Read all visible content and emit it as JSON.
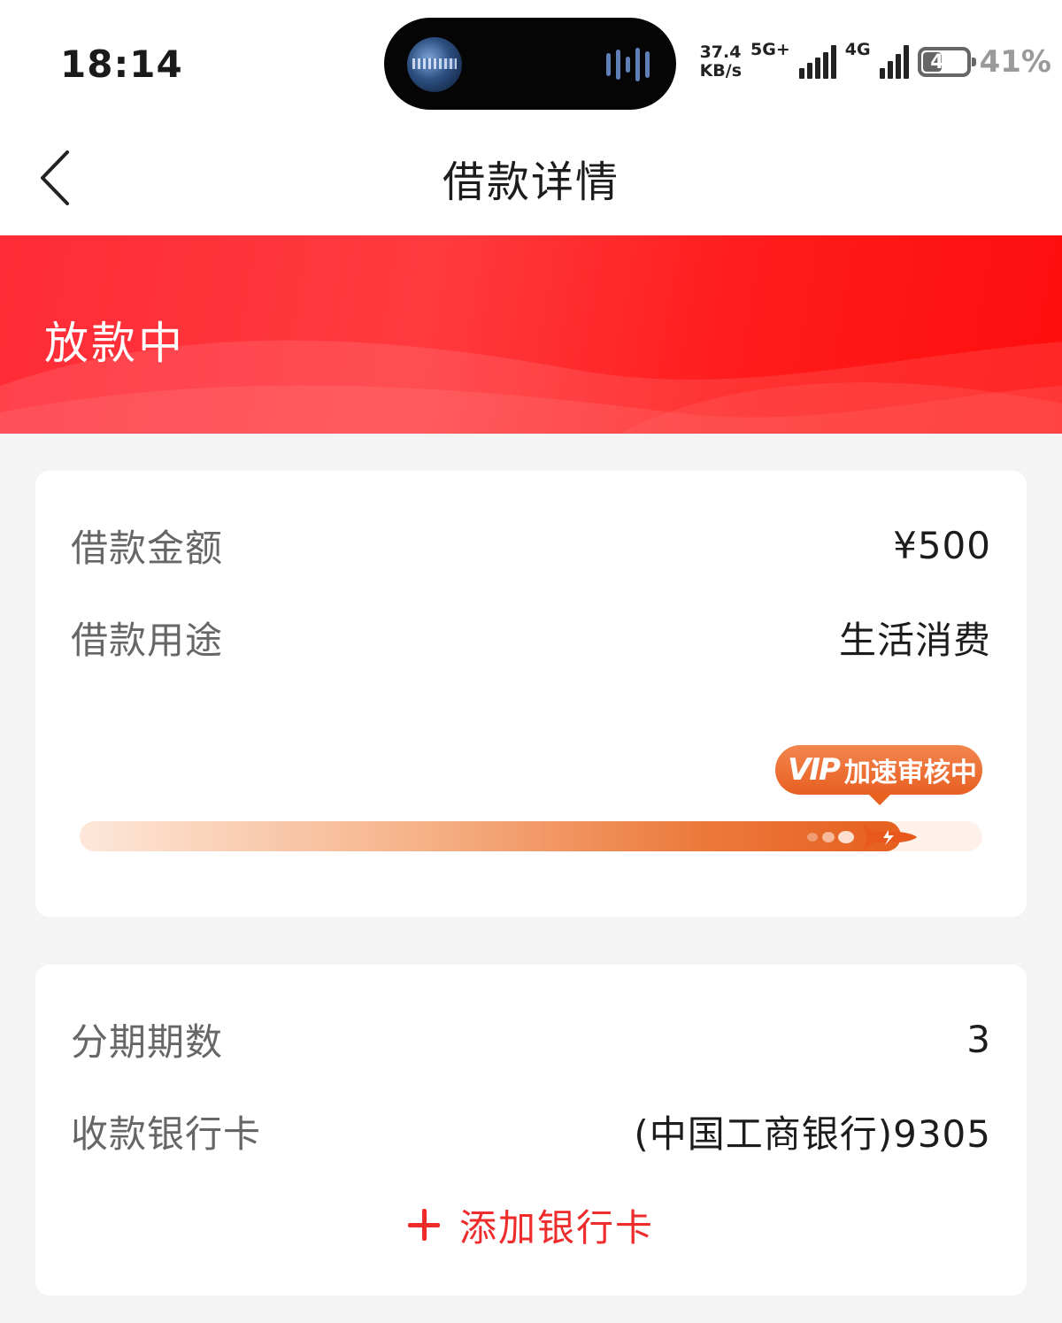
{
  "status_bar": {
    "time": "18:14",
    "net_speed_value": "37.4",
    "net_speed_unit": "KB/s",
    "network_1": "5G+",
    "network_2": "4G",
    "battery_level": "41",
    "battery_percent": "41%"
  },
  "nav": {
    "title": "借款详情"
  },
  "banner": {
    "status": "放款中"
  },
  "loan_card": {
    "amount_label": "借款金额",
    "amount_value": "¥500",
    "purpose_label": "借款用途",
    "purpose_value": "生活消费",
    "vip_mark": "VIP",
    "vip_text": "加速审核中",
    "progress": 0.91
  },
  "repay_card": {
    "installments_label": "分期期数",
    "installments_value": "3",
    "bank_label": "收款银行卡",
    "bank_value": "(中国工商银行)9305",
    "add_card_label": "添加银行卡"
  },
  "colors": {
    "brand_red": "#ff2b36",
    "accent_red": "#ef2c2c",
    "progress_orange": "#e65f1e"
  }
}
